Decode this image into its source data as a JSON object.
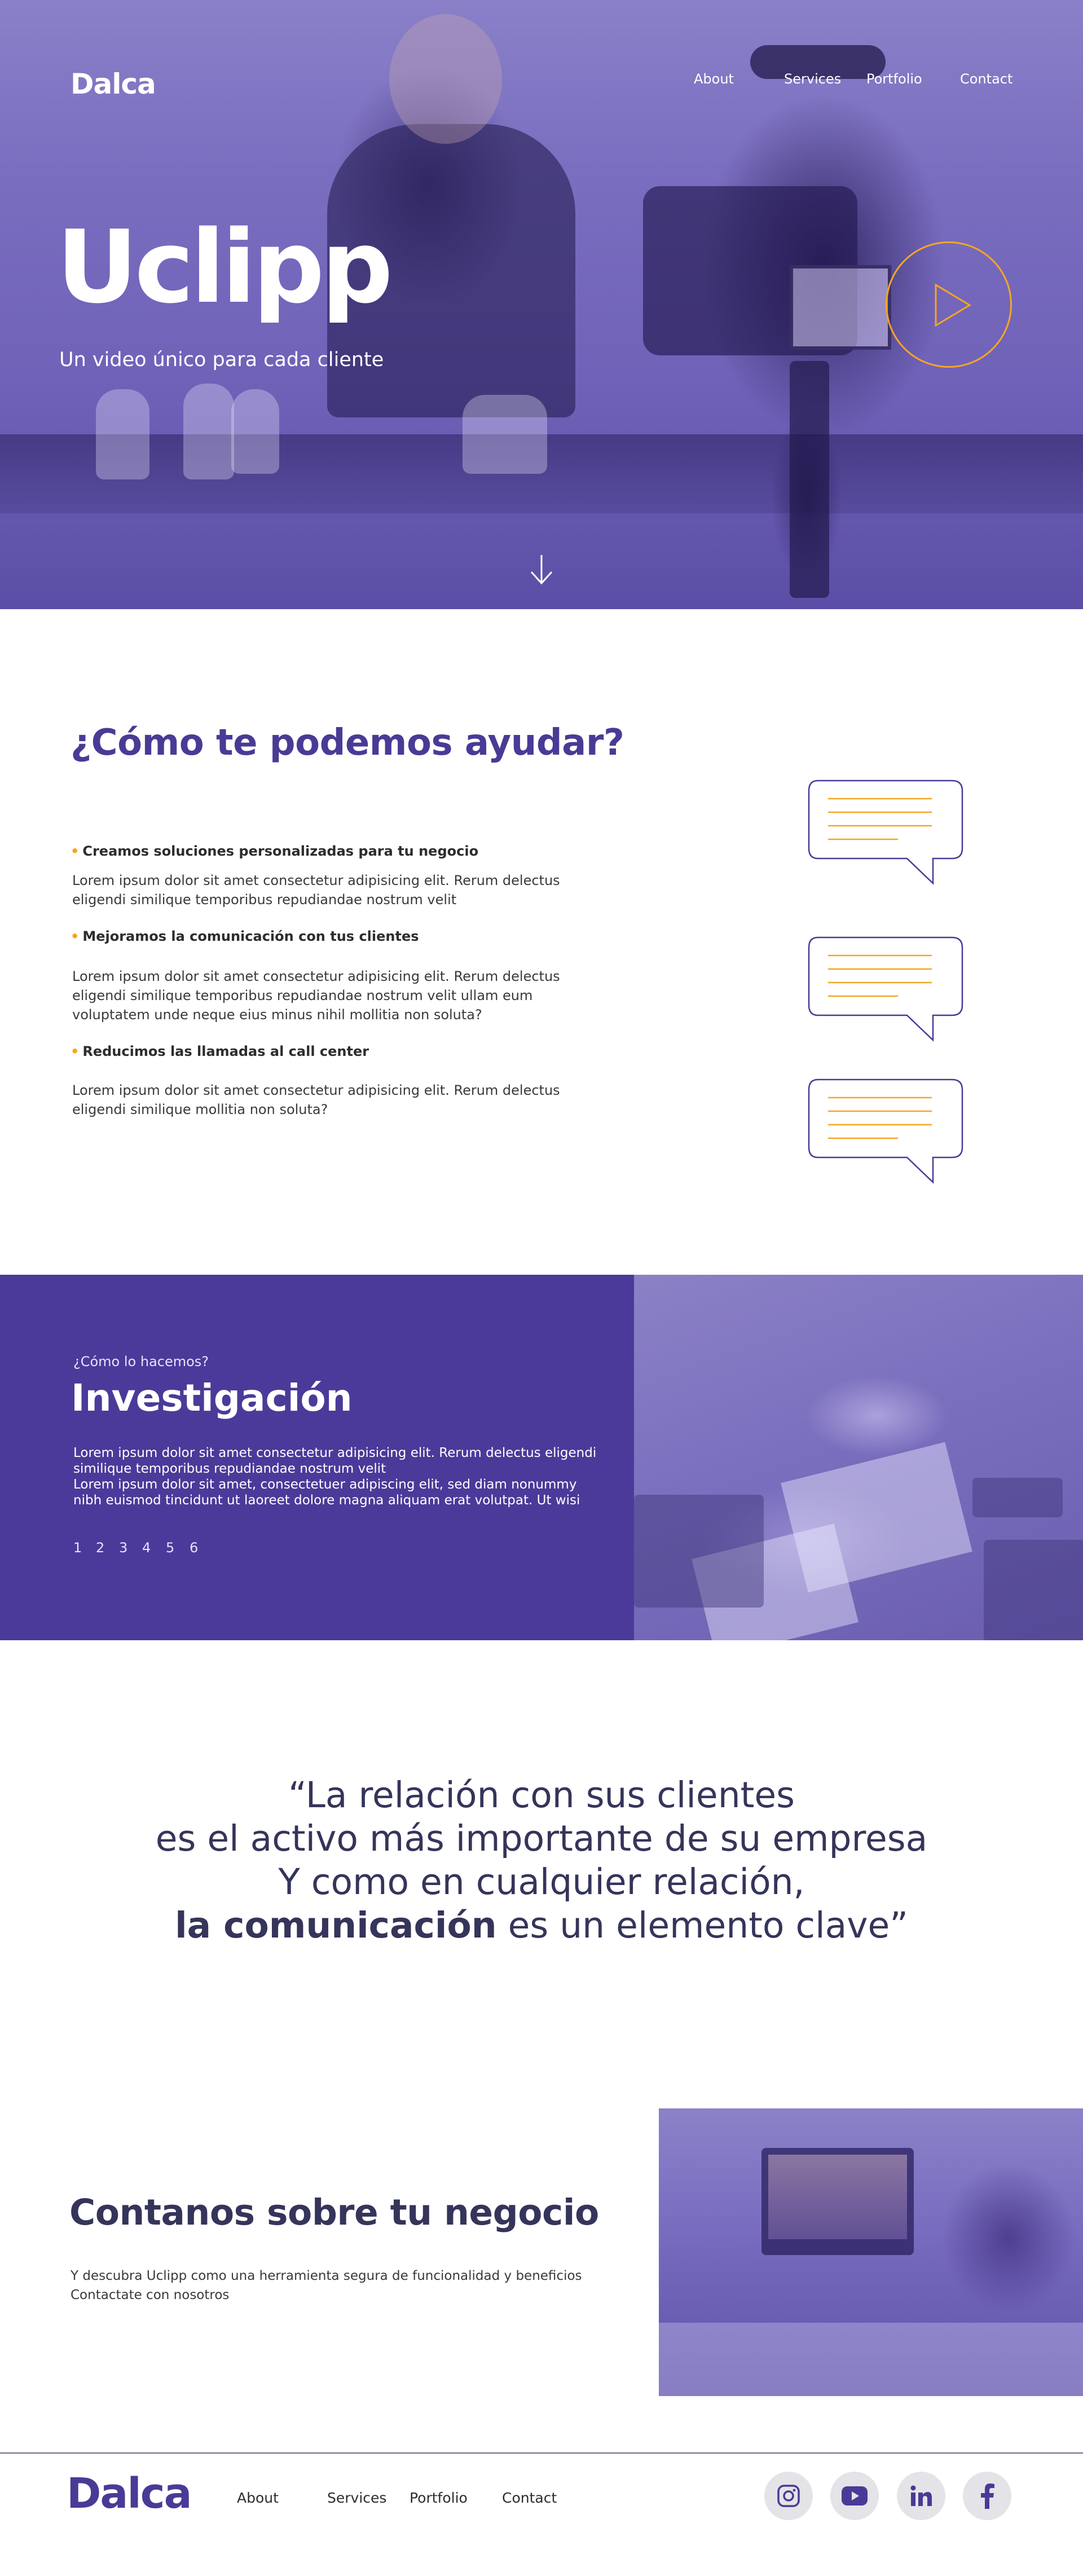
{
  "brand": {
    "name": "Dalca",
    "accent": "#4a3a96",
    "highlight": "#f5a623"
  },
  "nav": {
    "about": "About",
    "services": "Services",
    "portfolio": "Portfolio",
    "contact": "Contact"
  },
  "hero": {
    "title": "Uclipp",
    "subtitle": "Un video único para cada cliente"
  },
  "help": {
    "heading": "¿Cómo te podemos ayudar?",
    "bullet": "•",
    "items": [
      {
        "title": "Creamos soluciones personalizadas para tu negocio",
        "text": "Lorem ipsum dolor sit amet consectetur adipisicing elit. Rerum delectus eligendi similique temporibus repudiandae nostrum velit"
      },
      {
        "title": "Mejoramos la comunicación con tus clientes",
        "text": "Lorem ipsum dolor sit amet consectetur adipisicing elit. Rerum delectus eligendi similique temporibus repudiandae nostrum velit ullam eum voluptatem unde neque eius minus nihil mollitia non soluta?"
      },
      {
        "title": "Reducimos las llamadas al call center",
        "text": "Lorem ipsum dolor sit amet consectetur adipisicing elit. Rerum delectus eligendi similique mollitia non soluta?"
      }
    ]
  },
  "investigacion": {
    "kicker": "¿Cómo lo hacemos?",
    "title": "Investigación",
    "text_1": "Lorem ipsum dolor sit amet consectetur adipisicing elit. Rerum delectus eligendi similique temporibus repudiandae nostrum velit",
    "text_2": "Lorem ipsum dolor sit amet, consectetuer adipiscing elit, sed diam nonummy nibh euismod tincidunt ut laoreet dolore magna aliquam erat volutpat. Ut wisi",
    "steps": [
      "1",
      "2",
      "3",
      "4",
      "5",
      "6"
    ]
  },
  "quote": {
    "line1": "“La relación con sus clientes",
    "line2": "es el activo más importante de su empresa",
    "line3": "Y como en cualquier relación,",
    "line4_bold": "la comunicación",
    "line4_rest": " es un elemento clave”"
  },
  "business": {
    "heading": "Contanos sobre tu negocio",
    "text_1": "Y descubra Uclipp como una herramienta segura de funcionalidad y beneficios",
    "text_2": "Contactate con nosotros"
  },
  "social": [
    "instagram-icon",
    "youtube-icon",
    "linkedin-icon",
    "facebook-icon"
  ]
}
